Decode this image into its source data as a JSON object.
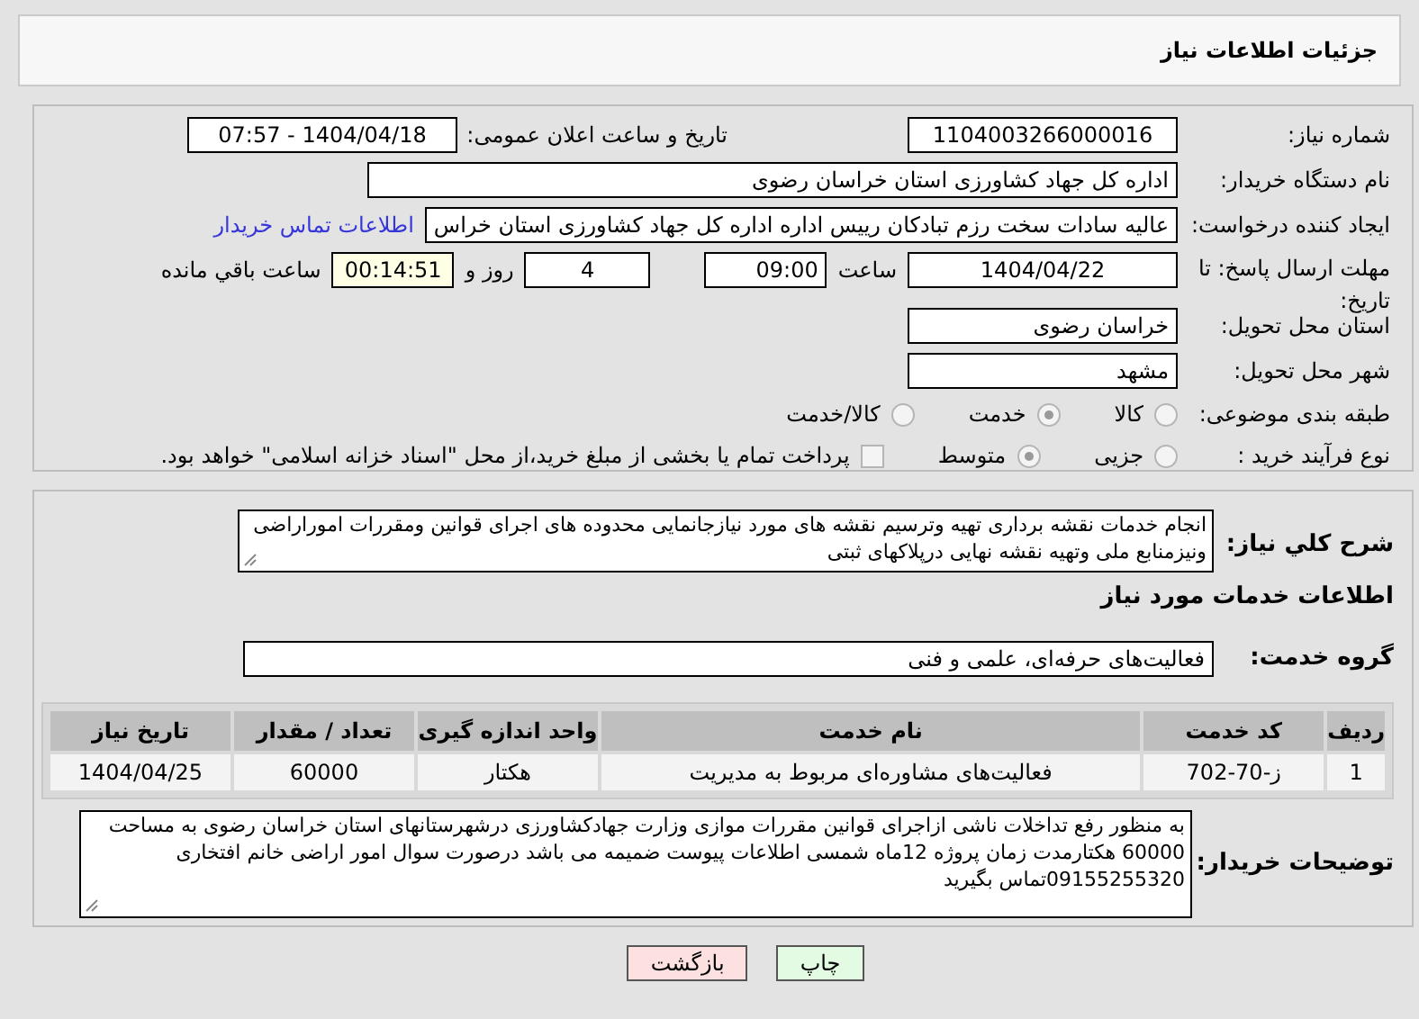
{
  "header": {
    "title": "جزئیات اطلاعات نیاز"
  },
  "need_number": {
    "label": "شماره نیاز:",
    "value": "1104003266000016"
  },
  "announce": {
    "label": "تاریخ و ساعت اعلان عمومی:",
    "value": "1404/04/18 - 07:57"
  },
  "buyer_org": {
    "label": "نام دستگاه خریدار:",
    "value": "اداره کل جهاد کشاورزی استان خراسان رضوی"
  },
  "creator": {
    "label": "ایجاد کننده درخواست:",
    "value": "عالیه سادات سخت رزم تبادکان رییس اداره  اداره کل جهاد کشاورزی استان خراس",
    "link": "اطلاعات تماس خریدار"
  },
  "deadline": {
    "label": "مهلت ارسال پاسخ: تا تاریخ:",
    "date": "1404/04/22",
    "time_label": "ساعت",
    "time": "09:00",
    "days": "4",
    "days_label": "روز و",
    "remaining": "00:14:51",
    "remaining_label": "ساعت باقي مانده"
  },
  "province": {
    "label": "استان محل تحویل:",
    "value": "خراسان رضوی"
  },
  "city": {
    "label": "شهر محل تحویل:",
    "value": "مشهد"
  },
  "category": {
    "label": "طبقه بندی موضوعی:",
    "options": [
      {
        "label": "کالا",
        "selected": false
      },
      {
        "label": "خدمت",
        "selected": true
      },
      {
        "label": "کالا/خدمت",
        "selected": false
      }
    ]
  },
  "process": {
    "label": "نوع فرآیند خرید :",
    "options": [
      {
        "label": "جزیی",
        "selected": false
      },
      {
        "label": "متوسط",
        "selected": true
      }
    ],
    "treasury": {
      "checked": false,
      "label": "پرداخت تمام یا بخشی از مبلغ خرید،از محل \"اسناد خزانه اسلامی\" خواهد بود."
    }
  },
  "description": {
    "label": "شرح کلي نياز:",
    "value": "انجام خدمات نقشه برداری تهیه وترسیم نقشه های مورد نیازجانمایی محدوده های اجرای قوانین ومقررات اموراراضی ونیزمنابع ملی وتهیه نقشه نهایی درپلاکهای ثبتی"
  },
  "services_heading": "اطلاعات خدمات مورد نیاز",
  "service_group": {
    "label": "گروه خدمت:",
    "value": "فعالیت‌های حرفه‌ای، علمی و فنی"
  },
  "table": {
    "columns": [
      "ردیف",
      "کد خدمت",
      "نام خدمت",
      "واحد اندازه گیری",
      "تعداد / مقدار",
      "تاریخ نیاز"
    ],
    "rows": [
      [
        "1",
        "ز-70-702",
        "فعالیت‌های مشاوره‌ای مربوط به مدیریت",
        "هکتار",
        "60000",
        "1404/04/25"
      ]
    ]
  },
  "buyer_notes": {
    "label": "توضیحات خریدار:",
    "value": "به منظور رفع تداخلات ناشی ازاجرای قوانین مقررات موازی وزارت جهادکشاورزی درشهرستانهای استان خراسان رضوی به مساحت 60000 هکتارمدت زمان پروژه 12ماه  شمسی  اطلاعات پیوست ضمیمه می باشد درصورت سوال امور اراضی خانم افتخاری 09155255320تماس بگیرید"
  },
  "buttons": [
    {
      "label": "چاپ",
      "kind": "print"
    },
    {
      "label": "بازگشت",
      "kind": "back"
    }
  ]
}
